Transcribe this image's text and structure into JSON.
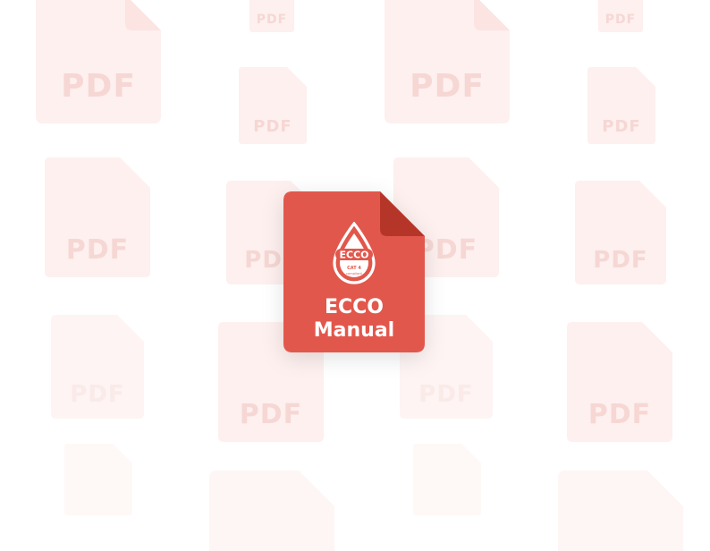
{
  "background_label": "PDF",
  "drop_logo_text": "ECCO",
  "drop_logo_small_line1": "CAT 4",
  "drop_logo_small_line2": "compliant",
  "card_title_line1": "ECCO",
  "card_title_line2": "Manual",
  "colors": {
    "card": "#e2574c",
    "card_fold": "#b53629",
    "faded_doc": "#fdf1f0",
    "faded_text": "#f6d7d4"
  }
}
